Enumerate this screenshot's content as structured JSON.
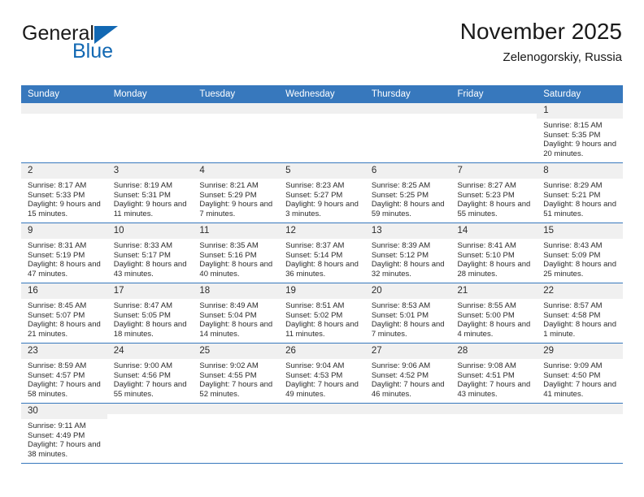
{
  "brand": {
    "name_part1": "General",
    "name_part2": "Blue",
    "triangle_color": "#1268b3"
  },
  "header": {
    "title": "November 2025",
    "subtitle": "Zelenogorskiy, Russia",
    "accent_color": "#3778bd"
  },
  "weekday_headers": [
    "Sunday",
    "Monday",
    "Tuesday",
    "Wednesday",
    "Thursday",
    "Friday",
    "Saturday"
  ],
  "weeks": [
    [
      {
        "day": "",
        "sunrise": "",
        "sunset": "",
        "daylight": "",
        "empty": true
      },
      {
        "day": "",
        "sunrise": "",
        "sunset": "",
        "daylight": "",
        "empty": true
      },
      {
        "day": "",
        "sunrise": "",
        "sunset": "",
        "daylight": "",
        "empty": true
      },
      {
        "day": "",
        "sunrise": "",
        "sunset": "",
        "daylight": "",
        "empty": true
      },
      {
        "day": "",
        "sunrise": "",
        "sunset": "",
        "daylight": "",
        "empty": true
      },
      {
        "day": "",
        "sunrise": "",
        "sunset": "",
        "daylight": "",
        "empty": true
      },
      {
        "day": "1",
        "sunrise": "Sunrise: 8:15 AM",
        "sunset": "Sunset: 5:35 PM",
        "daylight": "Daylight: 9 hours and 20 minutes."
      }
    ],
    [
      {
        "day": "2",
        "sunrise": "Sunrise: 8:17 AM",
        "sunset": "Sunset: 5:33 PM",
        "daylight": "Daylight: 9 hours and 15 minutes."
      },
      {
        "day": "3",
        "sunrise": "Sunrise: 8:19 AM",
        "sunset": "Sunset: 5:31 PM",
        "daylight": "Daylight: 9 hours and 11 minutes."
      },
      {
        "day": "4",
        "sunrise": "Sunrise: 8:21 AM",
        "sunset": "Sunset: 5:29 PM",
        "daylight": "Daylight: 9 hours and 7 minutes."
      },
      {
        "day": "5",
        "sunrise": "Sunrise: 8:23 AM",
        "sunset": "Sunset: 5:27 PM",
        "daylight": "Daylight: 9 hours and 3 minutes."
      },
      {
        "day": "6",
        "sunrise": "Sunrise: 8:25 AM",
        "sunset": "Sunset: 5:25 PM",
        "daylight": "Daylight: 8 hours and 59 minutes."
      },
      {
        "day": "7",
        "sunrise": "Sunrise: 8:27 AM",
        "sunset": "Sunset: 5:23 PM",
        "daylight": "Daylight: 8 hours and 55 minutes."
      },
      {
        "day": "8",
        "sunrise": "Sunrise: 8:29 AM",
        "sunset": "Sunset: 5:21 PM",
        "daylight": "Daylight: 8 hours and 51 minutes."
      }
    ],
    [
      {
        "day": "9",
        "sunrise": "Sunrise: 8:31 AM",
        "sunset": "Sunset: 5:19 PM",
        "daylight": "Daylight: 8 hours and 47 minutes."
      },
      {
        "day": "10",
        "sunrise": "Sunrise: 8:33 AM",
        "sunset": "Sunset: 5:17 PM",
        "daylight": "Daylight: 8 hours and 43 minutes."
      },
      {
        "day": "11",
        "sunrise": "Sunrise: 8:35 AM",
        "sunset": "Sunset: 5:16 PM",
        "daylight": "Daylight: 8 hours and 40 minutes."
      },
      {
        "day": "12",
        "sunrise": "Sunrise: 8:37 AM",
        "sunset": "Sunset: 5:14 PM",
        "daylight": "Daylight: 8 hours and 36 minutes."
      },
      {
        "day": "13",
        "sunrise": "Sunrise: 8:39 AM",
        "sunset": "Sunset: 5:12 PM",
        "daylight": "Daylight: 8 hours and 32 minutes."
      },
      {
        "day": "14",
        "sunrise": "Sunrise: 8:41 AM",
        "sunset": "Sunset: 5:10 PM",
        "daylight": "Daylight: 8 hours and 28 minutes."
      },
      {
        "day": "15",
        "sunrise": "Sunrise: 8:43 AM",
        "sunset": "Sunset: 5:09 PM",
        "daylight": "Daylight: 8 hours and 25 minutes."
      }
    ],
    [
      {
        "day": "16",
        "sunrise": "Sunrise: 8:45 AM",
        "sunset": "Sunset: 5:07 PM",
        "daylight": "Daylight: 8 hours and 21 minutes."
      },
      {
        "day": "17",
        "sunrise": "Sunrise: 8:47 AM",
        "sunset": "Sunset: 5:05 PM",
        "daylight": "Daylight: 8 hours and 18 minutes."
      },
      {
        "day": "18",
        "sunrise": "Sunrise: 8:49 AM",
        "sunset": "Sunset: 5:04 PM",
        "daylight": "Daylight: 8 hours and 14 minutes."
      },
      {
        "day": "19",
        "sunrise": "Sunrise: 8:51 AM",
        "sunset": "Sunset: 5:02 PM",
        "daylight": "Daylight: 8 hours and 11 minutes."
      },
      {
        "day": "20",
        "sunrise": "Sunrise: 8:53 AM",
        "sunset": "Sunset: 5:01 PM",
        "daylight": "Daylight: 8 hours and 7 minutes."
      },
      {
        "day": "21",
        "sunrise": "Sunrise: 8:55 AM",
        "sunset": "Sunset: 5:00 PM",
        "daylight": "Daylight: 8 hours and 4 minutes."
      },
      {
        "day": "22",
        "sunrise": "Sunrise: 8:57 AM",
        "sunset": "Sunset: 4:58 PM",
        "daylight": "Daylight: 8 hours and 1 minute."
      }
    ],
    [
      {
        "day": "23",
        "sunrise": "Sunrise: 8:59 AM",
        "sunset": "Sunset: 4:57 PM",
        "daylight": "Daylight: 7 hours and 58 minutes."
      },
      {
        "day": "24",
        "sunrise": "Sunrise: 9:00 AM",
        "sunset": "Sunset: 4:56 PM",
        "daylight": "Daylight: 7 hours and 55 minutes."
      },
      {
        "day": "25",
        "sunrise": "Sunrise: 9:02 AM",
        "sunset": "Sunset: 4:55 PM",
        "daylight": "Daylight: 7 hours and 52 minutes."
      },
      {
        "day": "26",
        "sunrise": "Sunrise: 9:04 AM",
        "sunset": "Sunset: 4:53 PM",
        "daylight": "Daylight: 7 hours and 49 minutes."
      },
      {
        "day": "27",
        "sunrise": "Sunrise: 9:06 AM",
        "sunset": "Sunset: 4:52 PM",
        "daylight": "Daylight: 7 hours and 46 minutes."
      },
      {
        "day": "28",
        "sunrise": "Sunrise: 9:08 AM",
        "sunset": "Sunset: 4:51 PM",
        "daylight": "Daylight: 7 hours and 43 minutes."
      },
      {
        "day": "29",
        "sunrise": "Sunrise: 9:09 AM",
        "sunset": "Sunset: 4:50 PM",
        "daylight": "Daylight: 7 hours and 41 minutes."
      }
    ],
    [
      {
        "day": "30",
        "sunrise": "Sunrise: 9:11 AM",
        "sunset": "Sunset: 4:49 PM",
        "daylight": "Daylight: 7 hours and 38 minutes."
      },
      {
        "day": "",
        "sunrise": "",
        "sunset": "",
        "daylight": "",
        "empty": true
      },
      {
        "day": "",
        "sunrise": "",
        "sunset": "",
        "daylight": "",
        "empty": true
      },
      {
        "day": "",
        "sunrise": "",
        "sunset": "",
        "daylight": "",
        "empty": true
      },
      {
        "day": "",
        "sunrise": "",
        "sunset": "",
        "daylight": "",
        "empty": true
      },
      {
        "day": "",
        "sunrise": "",
        "sunset": "",
        "daylight": "",
        "empty": true
      },
      {
        "day": "",
        "sunrise": "",
        "sunset": "",
        "daylight": "",
        "empty": true
      }
    ]
  ]
}
